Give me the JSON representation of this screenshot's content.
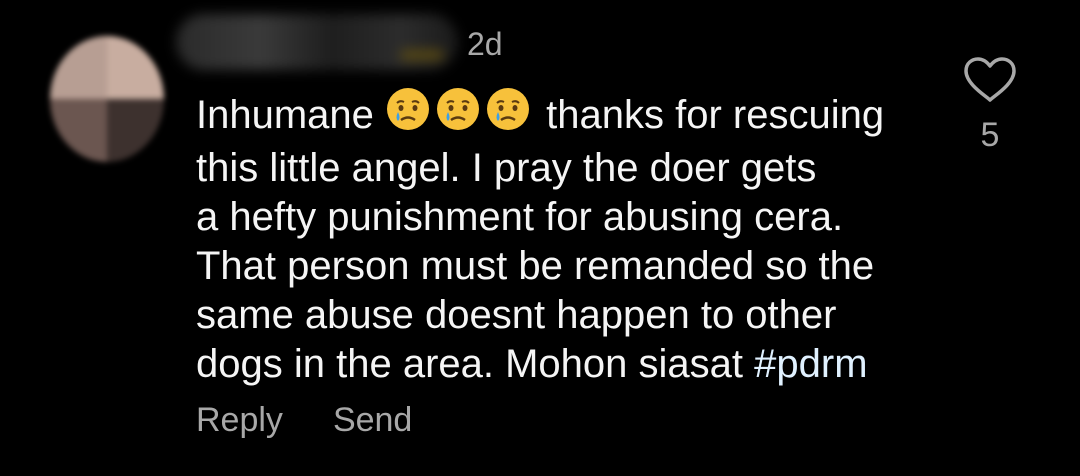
{
  "comment": {
    "time": "2d",
    "text_lines": {
      "l1_a": "Inhumane",
      "l1_b": "thanks for rescuing",
      "l2": "this little angel.  I pray the doer gets",
      "l3": "a hefty punishment for abusing cera.",
      "l4": "That person must be remanded so the",
      "l5": "same abuse doesnt happen to other",
      "l6_a": "dogs in the area.  Mohon siasat",
      "l6_hashtag": "#pdrm"
    },
    "emojis": [
      "crying-face-emoji",
      "crying-face-emoji",
      "crying-face-emoji"
    ],
    "reply_label": "Reply",
    "send_label": "Send",
    "like_count": "5",
    "like_icon": "heart-outline-icon"
  },
  "colors": {
    "background": "#000000",
    "text": "#f5f5f5",
    "secondary": "#a8a8a8",
    "hashtag": "#e0f1ff"
  }
}
